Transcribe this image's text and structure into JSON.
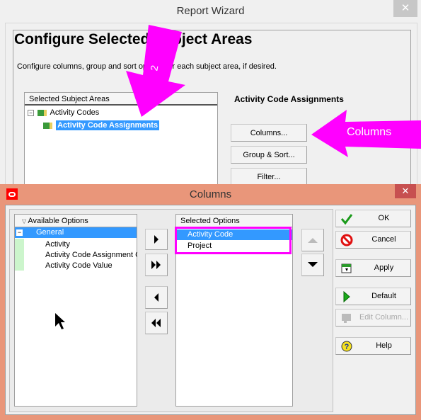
{
  "wizard": {
    "title": "Report Wizard",
    "heading": "Configure Selected Subject Areas",
    "description": "Configure columns, group and sort options for each subject area, if desired.",
    "tree_header": "Selected Subject Areas",
    "tree": [
      {
        "label": "Activity Codes"
      },
      {
        "label": "Activity Code Assignments",
        "selected": true
      }
    ],
    "selected_area_title": "Activity Code Assignments",
    "buttons": {
      "columns": "Columns...",
      "group_sort": "Group & Sort...",
      "filter": "Filter..."
    }
  },
  "annotations": {
    "arrow_number": "2",
    "arrow_label": "Columns",
    "color": "#ff00ff"
  },
  "columns_dialog": {
    "title": "Columns",
    "accent": "#e9967a",
    "available_header": "Available Options",
    "available": {
      "group": "General",
      "items": [
        "Activity",
        "Activity Code Assignment C",
        "Activity Code Value"
      ]
    },
    "selected_header": "Selected Options",
    "selected": [
      {
        "label": "Activity Code",
        "selected": true
      },
      {
        "label": "Project"
      }
    ],
    "buttons": {
      "ok": "OK",
      "cancel": "Cancel",
      "apply": "Apply",
      "default": "Default",
      "edit_column": "Edit Column...",
      "help": "Help"
    }
  }
}
